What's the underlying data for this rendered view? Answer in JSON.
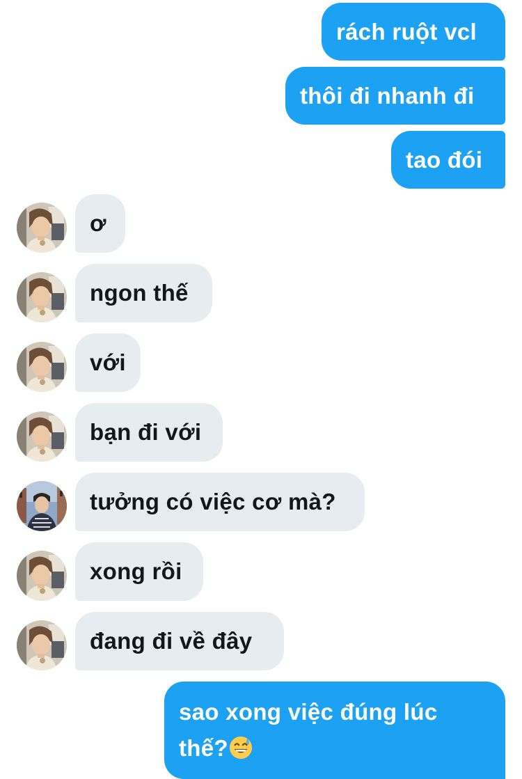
{
  "conversation": {
    "messages": [
      {
        "side": "out",
        "text": "rách ruột vcl"
      },
      {
        "side": "out",
        "text": "thôi đi nhanh đi"
      },
      {
        "side": "out",
        "text": "tao đói"
      },
      {
        "side": "in",
        "text": "ơ",
        "avatar": "contact-avatar"
      },
      {
        "side": "in",
        "text": "ngon thế",
        "avatar": "contact-avatar"
      },
      {
        "side": "in",
        "text": "với",
        "avatar": "contact-avatar"
      },
      {
        "side": "in",
        "text": "bạn đi với",
        "avatar": "contact-avatar"
      },
      {
        "side": "in",
        "text": "tưởng có việc cơ mà?",
        "avatar": "contact-avatar-alt"
      },
      {
        "side": "in",
        "text": "xong rồi",
        "avatar": "contact-avatar"
      },
      {
        "side": "in",
        "text": "đang đi về đây",
        "avatar": "contact-avatar"
      },
      {
        "side": "out",
        "text_line1": "sao xong việc đúng lúc",
        "text_line2": "thế?",
        "emoji": "grinning-sweat-emoji"
      }
    ]
  },
  "colors": {
    "outgoing_bubble": "#1da1f2",
    "incoming_bubble": "#e6ecf0",
    "incoming_text": "#14171a",
    "outgoing_text": "#ffffff"
  }
}
